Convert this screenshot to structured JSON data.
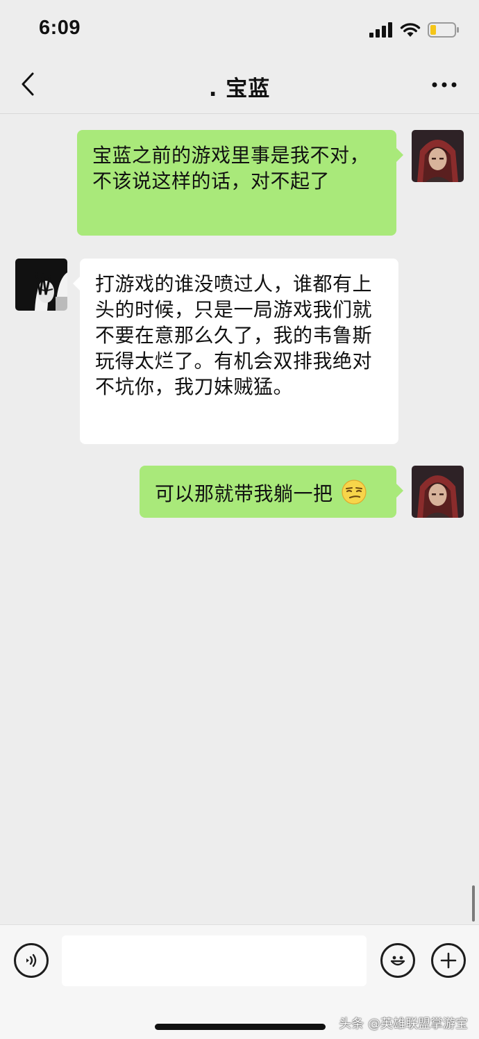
{
  "status_bar": {
    "time": "6:09"
  },
  "nav": {
    "title": ". 宝蓝"
  },
  "messages": [
    {
      "direction": "out",
      "text": "宝蓝之前的游戏里事是我不对，不该说这样的话，对不起了"
    },
    {
      "direction": "in",
      "text": "打游戏的谁没喷过人，谁都有上头的时候，只是一局游戏我们就不要在意那么久了，我的韦鲁斯玩得太烂了。有机会双排我绝对不坑你，我刀妹贼猛。"
    },
    {
      "direction": "out",
      "text": "可以那就带我躺一把",
      "emoji": "smirk-emoji"
    }
  ],
  "input": {
    "placeholder": ""
  },
  "watermark": "头条 @英雄联盟掌游宝",
  "colors": {
    "background": "#ededed",
    "outgoing_bubble": "#a9e97a",
    "incoming_bubble": "#ffffff",
    "battery": "#f5c518"
  }
}
